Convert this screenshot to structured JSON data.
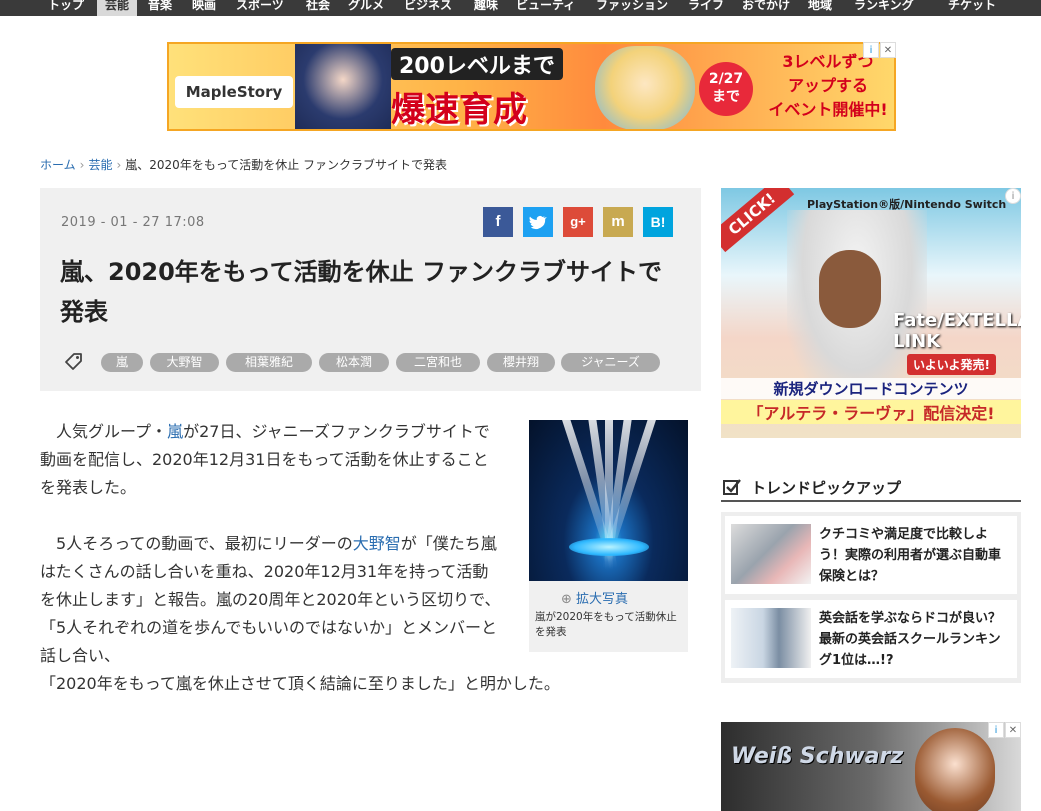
{
  "nav": {
    "items": [
      "トップ",
      "芸能",
      "音楽",
      "映画",
      "スポーツ",
      "社会",
      "グルメ",
      "ビジネス",
      "趣味",
      "ビューティ",
      "ファッション",
      "ライフ",
      "おでかけ",
      "地域",
      "ランキング",
      "チケット"
    ],
    "active_index": 1
  },
  "top_ad": {
    "logo": "MapleStory",
    "headline1": "200レベルまで",
    "headline2": "爆速育成",
    "date_line1": "2/27",
    "date_line2": "まで",
    "event_line1": "3レベルずつ",
    "event_line2": "アップする",
    "event_line3": "イベント開催中!",
    "ad_choice": "i"
  },
  "breadcrumb": {
    "home": "ホーム",
    "category": "芸能",
    "current": "嵐、2020年をもって活動を休止 ファンクラブサイトで発表"
  },
  "article": {
    "date": "2019 - 01 - 27  17:08",
    "title": "嵐、2020年をもって活動を休止 ファンクラブサイトで発表",
    "share": [
      {
        "label": "f",
        "color": "#3b5998"
      },
      {
        "label": "t",
        "color": "#1da1f2"
      },
      {
        "label": "g+",
        "color": "#dd4b39"
      },
      {
        "label": "m",
        "color": "#c8a951"
      },
      {
        "label": "B!",
        "color": "#00a4de"
      }
    ],
    "tags": [
      "嵐",
      "大野智",
      "相葉雅紀",
      "松本潤",
      "二宮和也",
      "櫻井翔",
      "ジャニーズ"
    ],
    "p1_before": "人気グループ・",
    "p1_link": "嵐",
    "p1_after": "が27日、ジャニーズファンクラブサイトで動画を配信し、2020年12月31日をもって活動を休止することを発表した。",
    "p2_before": "5人そろっての動画で、最初にリーダーの",
    "p2_link": "大野智",
    "p2_after": "が「僕たち嵐はたくさんの話し合いを重ね、2020年12月31年を持って活動を休止します」と報告。嵐の20周年と2020年という区切りで、「5人それぞれの道を歩んでもいいのではないか」とメンバーと話し合い、",
    "p3": "「2020年をもって嵐を休止させて頂く結論に至りました」と明かした。",
    "photo_zoom": "拡大写真",
    "photo_caption": "嵐が2020年をもって活動休止を発表"
  },
  "side_ad": {
    "click": "CLICK!",
    "platform": "PlayStation®版/Nintendo Switch",
    "logo": "Fate/EXTELLA LINK",
    "release": "いよいよ発売!",
    "line1": "新規ダウンロードコンテンツ",
    "line2": "「アルテラ・ラーヴァ」配信決定!"
  },
  "trend": {
    "title": "トレンドピックアップ",
    "items": [
      {
        "text": "クチコミや満足度で比較しよう！実際の利用者が選ぶ自動車保険とは？"
      },
      {
        "text": "英会話を学ぶならドコが良い？最新の英会話スクールランキング1位は…!?"
      }
    ]
  },
  "side_ad2": {
    "logo": "Weiß Schwarz"
  }
}
